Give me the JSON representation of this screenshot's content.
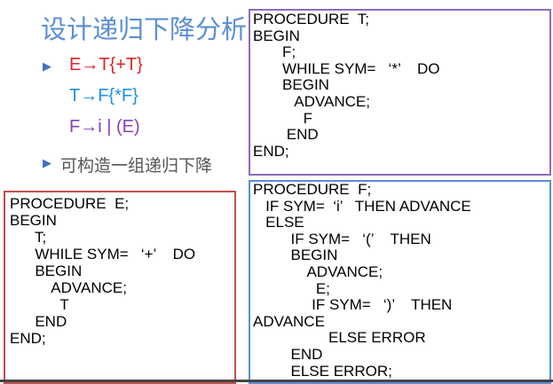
{
  "slide": {
    "title": "设计递归下降分析",
    "rules": [
      {
        "bullet": "▶",
        "text": "E→T{+T}"
      },
      {
        "text": "T→F{*F}"
      },
      {
        "text": "F→i | (E)"
      }
    ],
    "note": {
      "bullet": "▶",
      "text": "可构造一组递归下降"
    }
  },
  "procedures": {
    "t": "PROCEDURE  T;\nBEGIN\n       F;\n       WHILE SYM=   ‘*’    DO\n       BEGIN\n          ADVANCE;\n            F\n        END\nEND;",
    "f": "PROCEDURE  F;\n   IF SYM=  ‘i’   THEN ADVANCE\n   ELSE\n         IF SYM=   ‘(’    THEN\n         BEGIN\n             ADVANCE;\n               E;\n              IF SYM=   ‘)’    THEN\nADVANCE\n                  ELSE ERROR\n         END\n         ELSE ERROR;",
    "e": "PROCEDURE  E;\nBEGIN\n      T;\n      WHILE SYM=   ‘+’    DO\n      BEGIN\n          ADVANCE;\n            T\n      END\nEND;"
  }
}
